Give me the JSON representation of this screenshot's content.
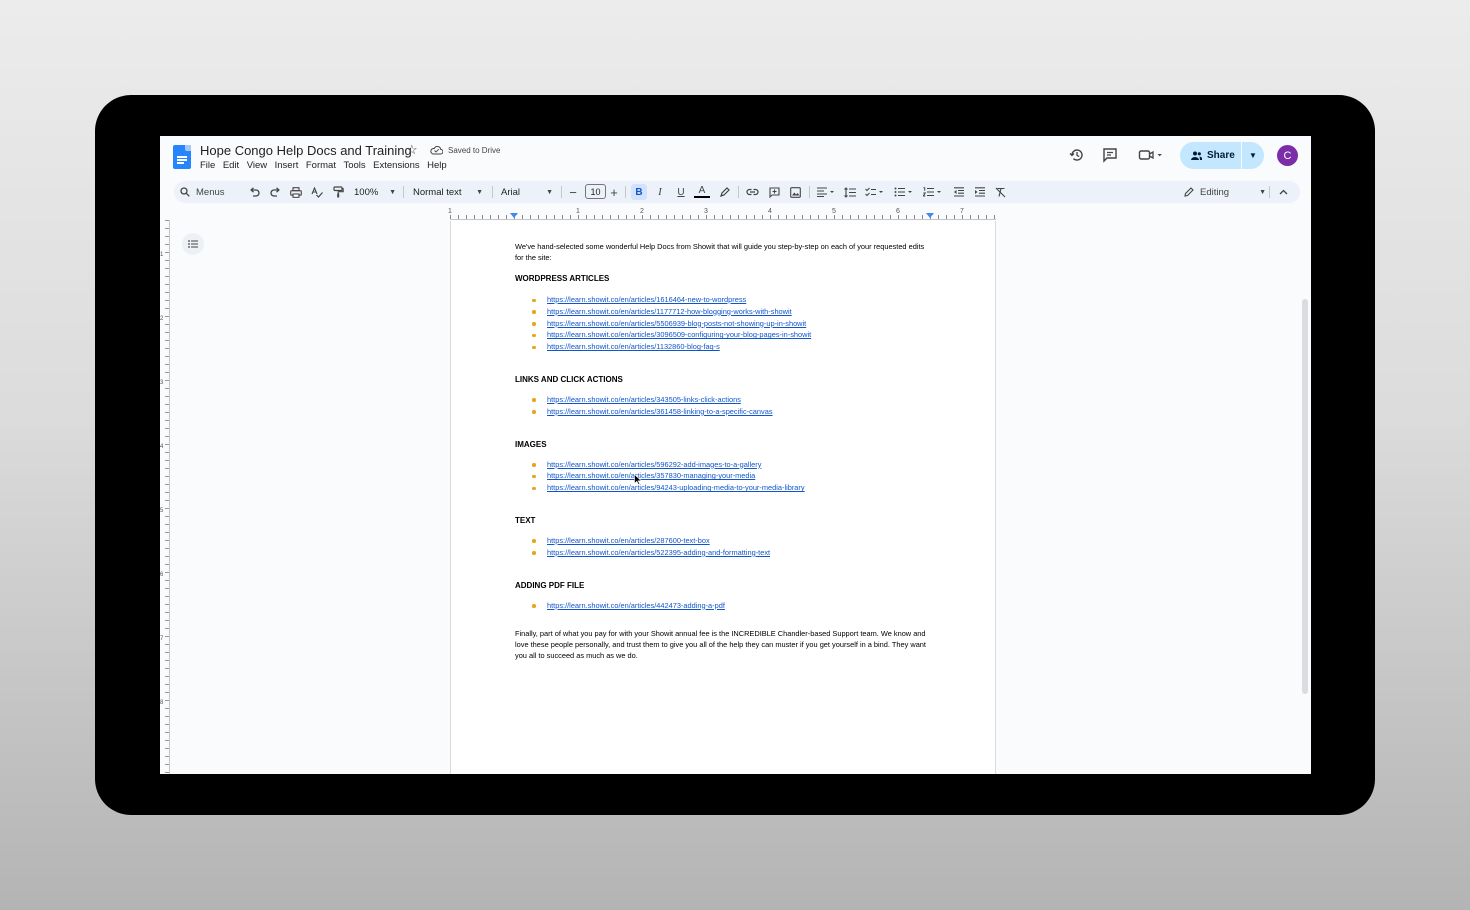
{
  "document": {
    "title": "Hope Congo Help Docs and Training",
    "save_status": "Saved to Drive"
  },
  "menu": [
    "File",
    "Edit",
    "View",
    "Insert",
    "Format",
    "Tools",
    "Extensions",
    "Help"
  ],
  "header_actions": {
    "share_label": "Share",
    "avatar_letter": "C"
  },
  "toolbar": {
    "menus_search": "Menus",
    "zoom": "100%",
    "style": "Normal text",
    "font": "Arial",
    "font_size": "10",
    "bold": "B",
    "italic": "I",
    "underline": "U",
    "text_color": "A",
    "mode": "Editing"
  },
  "ruler": {
    "h_labels": [
      "1",
      "1",
      "2",
      "3",
      "4",
      "5",
      "6",
      "7"
    ],
    "v_labels": [
      "1",
      "2",
      "3",
      "4",
      "5",
      "6",
      "7",
      "8"
    ]
  },
  "content": {
    "intro": "We've hand-selected some wonderful Help Docs from Showit that will guide you step-by-step on each of your requested edits for the site:",
    "sections": [
      {
        "heading": "WORDPRESS ARTICLES",
        "links": [
          "https://learn.showit.co/en/articles/1616464-new-to-wordpress",
          "https://learn.showit.co/en/articles/1177712-how-blogging-works-with-showit",
          "https://learn.showit.co/en/articles/5506939-blog-posts-not-showing-up-in-showit",
          "https://learn.showit.co/en/articles/3096509-configuring-your-blog-pages-in-showit",
          "https://learn.showit.co/en/articles/1132860-blog-faq-s"
        ]
      },
      {
        "heading": "LINKS AND CLICK ACTIONS",
        "links": [
          "https://learn.showit.co/en/articles/343505-links-click-actions",
          "https://learn.showit.co/en/articles/361458-linking-to-a-specific-canvas"
        ]
      },
      {
        "heading": "IMAGES",
        "links": [
          "https://learn.showit.co/en/articles/596292-add-images-to-a-gallery",
          "https://learn.showit.co/en/articles/357830-managing-your-media",
          "https://learn.showit.co/en/articles/94243-uploading-media-to-your-media-library"
        ]
      },
      {
        "heading": "TEXT",
        "links": [
          "https://learn.showit.co/en/articles/287600-text-box",
          "https://learn.showit.co/en/articles/522395-adding-and-formatting-text"
        ]
      },
      {
        "heading": "ADDING PDF FILE",
        "links": [
          "https://learn.showit.co/en/articles/442473-adding-a-pdf"
        ]
      }
    ],
    "closing": "Finally, part of what you pay for with your Showit annual fee is the INCREDIBLE Chandler-based Support team. We know and love these people personally, and trust them to give you all of the help they can muster if you get yourself in a bind. They want you all to succeed as much as we do."
  },
  "colors": {
    "link": "#1155cc",
    "bullet": "#e8a51a",
    "share_bg": "#c2e7ff",
    "avatar_bg": "#7b2ea8",
    "toolbar_bg": "#edf2fa"
  }
}
